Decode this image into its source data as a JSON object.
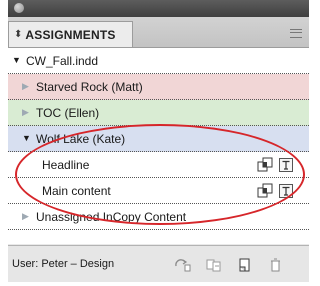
{
  "panel": {
    "tab_label": "ASSIGNMENTS",
    "sort_glyph": "⬍"
  },
  "list": {
    "document": {
      "name": "CW_Fall.indd",
      "arrow": "▼"
    },
    "assignments": [
      {
        "name": "Starved Rock (Matt)",
        "arrow": "▶",
        "color": "#f1d6d6"
      },
      {
        "name": "TOC (Ellen)",
        "arrow": "▶",
        "color": "#d9ecd3"
      },
      {
        "name": "Wolf Lake (Kate)",
        "arrow": "▼",
        "color": "#d7dff0"
      }
    ],
    "stories": [
      {
        "name": "Headline",
        "icons": [
          "link-icon",
          "text-frame-icon"
        ]
      },
      {
        "name": "Main content",
        "icons": [
          "link-icon",
          "text-frame-icon"
        ]
      }
    ],
    "unassigned": {
      "name": "Unassigned InCopy Content",
      "arrow": "▶"
    }
  },
  "status": {
    "user": "User: Peter – Design",
    "icons": [
      "update-content-icon",
      "update-all-icon",
      "new-assignment-icon",
      "delete-icon"
    ]
  },
  "colors": {
    "highlight_ellipse": "#d6262a",
    "starved_rock": "#f1d6d6",
    "toc": "#d9ecd3",
    "wolf_lake": "#d7dff0"
  }
}
